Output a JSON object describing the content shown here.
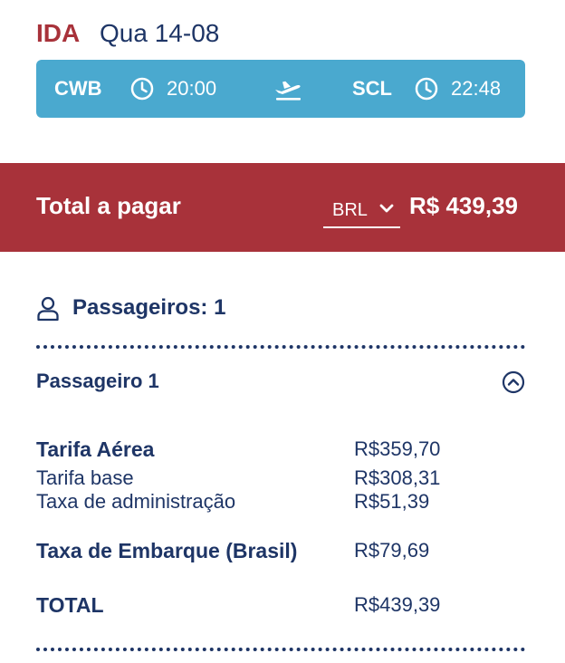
{
  "trip": {
    "direction": "IDA",
    "date": "Qua 14-08",
    "origin": "CWB",
    "departure_time": "20:00",
    "destination": "SCL",
    "arrival_time": "22:48",
    "icons": {
      "clock": "clock-icon",
      "plane": "plane-takeoff-icon"
    }
  },
  "total": {
    "label": "Total a pagar",
    "currency": "BRL",
    "amount": "R$ 439,39"
  },
  "passengers": {
    "count_label": "Passageiros: 1",
    "passenger_label": "Passageiro 1"
  },
  "fares": {
    "air_fare_label": "Tarifa Aérea",
    "air_fare_value": "R$359,70",
    "base_fare_label": "Tarifa base",
    "base_fare_value": "R$308,31",
    "admin_fee_label": "Taxa de administração",
    "admin_fee_value": "R$51,39",
    "boarding_tax_label": "Taxa de Embarque (Brasil)",
    "boarding_tax_value": "R$79,69",
    "total_label": "TOTAL",
    "total_value": "R$439,39"
  },
  "colors": {
    "navy": "#1e3566",
    "red": "#a8323a",
    "blue": "#4aa9cf"
  }
}
